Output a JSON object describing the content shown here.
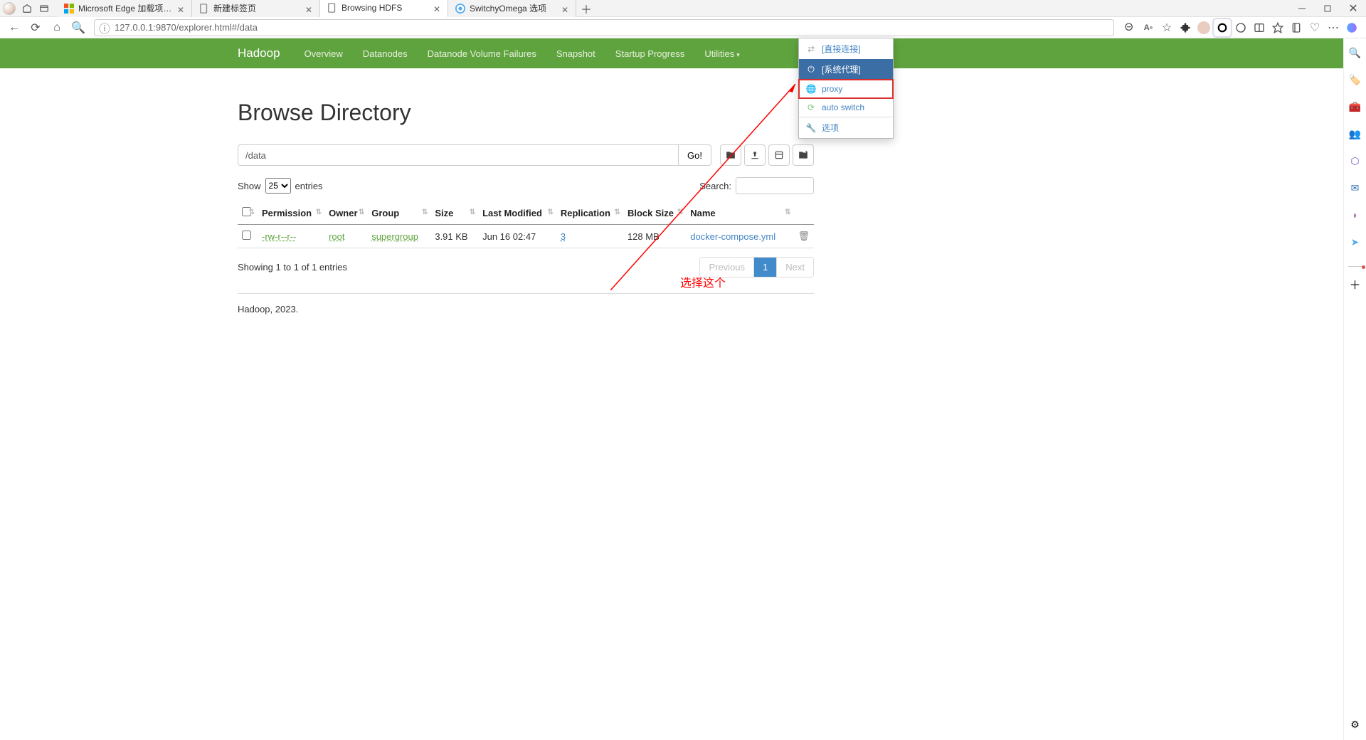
{
  "tabs": [
    {
      "title": "Microsoft Edge 加载项 - Switchy"
    },
    {
      "title": "新建标签页"
    },
    {
      "title": "Browsing HDFS"
    },
    {
      "title": "SwitchyOmega 选项"
    }
  ],
  "url": "127.0.0.1:9870/explorer.html#/data",
  "switchy": {
    "items": [
      {
        "label": "[直接连接]"
      },
      {
        "label": "[系统代理]"
      },
      {
        "label": "proxy"
      },
      {
        "label": "auto switch"
      },
      {
        "label": "选项"
      }
    ]
  },
  "nav": {
    "brand": "Hadoop",
    "items": [
      "Overview",
      "Datanodes",
      "Datanode Volume Failures",
      "Snapshot",
      "Startup Progress",
      "Utilities"
    ]
  },
  "page": {
    "heading": "Browse Directory",
    "path": "/data",
    "go": "Go!",
    "show": "Show",
    "entriesSuffix": "entries",
    "entriesValue": "25",
    "searchLabel": "Search:",
    "columns": [
      "",
      "Permission",
      "Owner",
      "Group",
      "Size",
      "Last Modified",
      "Replication",
      "Block Size",
      "Name",
      ""
    ],
    "row": {
      "permission": "-rw-r--r--",
      "owner": "root",
      "group": "supergroup",
      "size": "3.91 KB",
      "modified": "Jun 16 02:47",
      "replication": "3",
      "blocksize": "128 MB",
      "name": "docker-compose.yml"
    },
    "info": "Showing 1 to 1 of 1 entries",
    "prev": "Previous",
    "page1": "1",
    "next": "Next",
    "footer": "Hadoop, 2023."
  },
  "annotation": "选择这个"
}
